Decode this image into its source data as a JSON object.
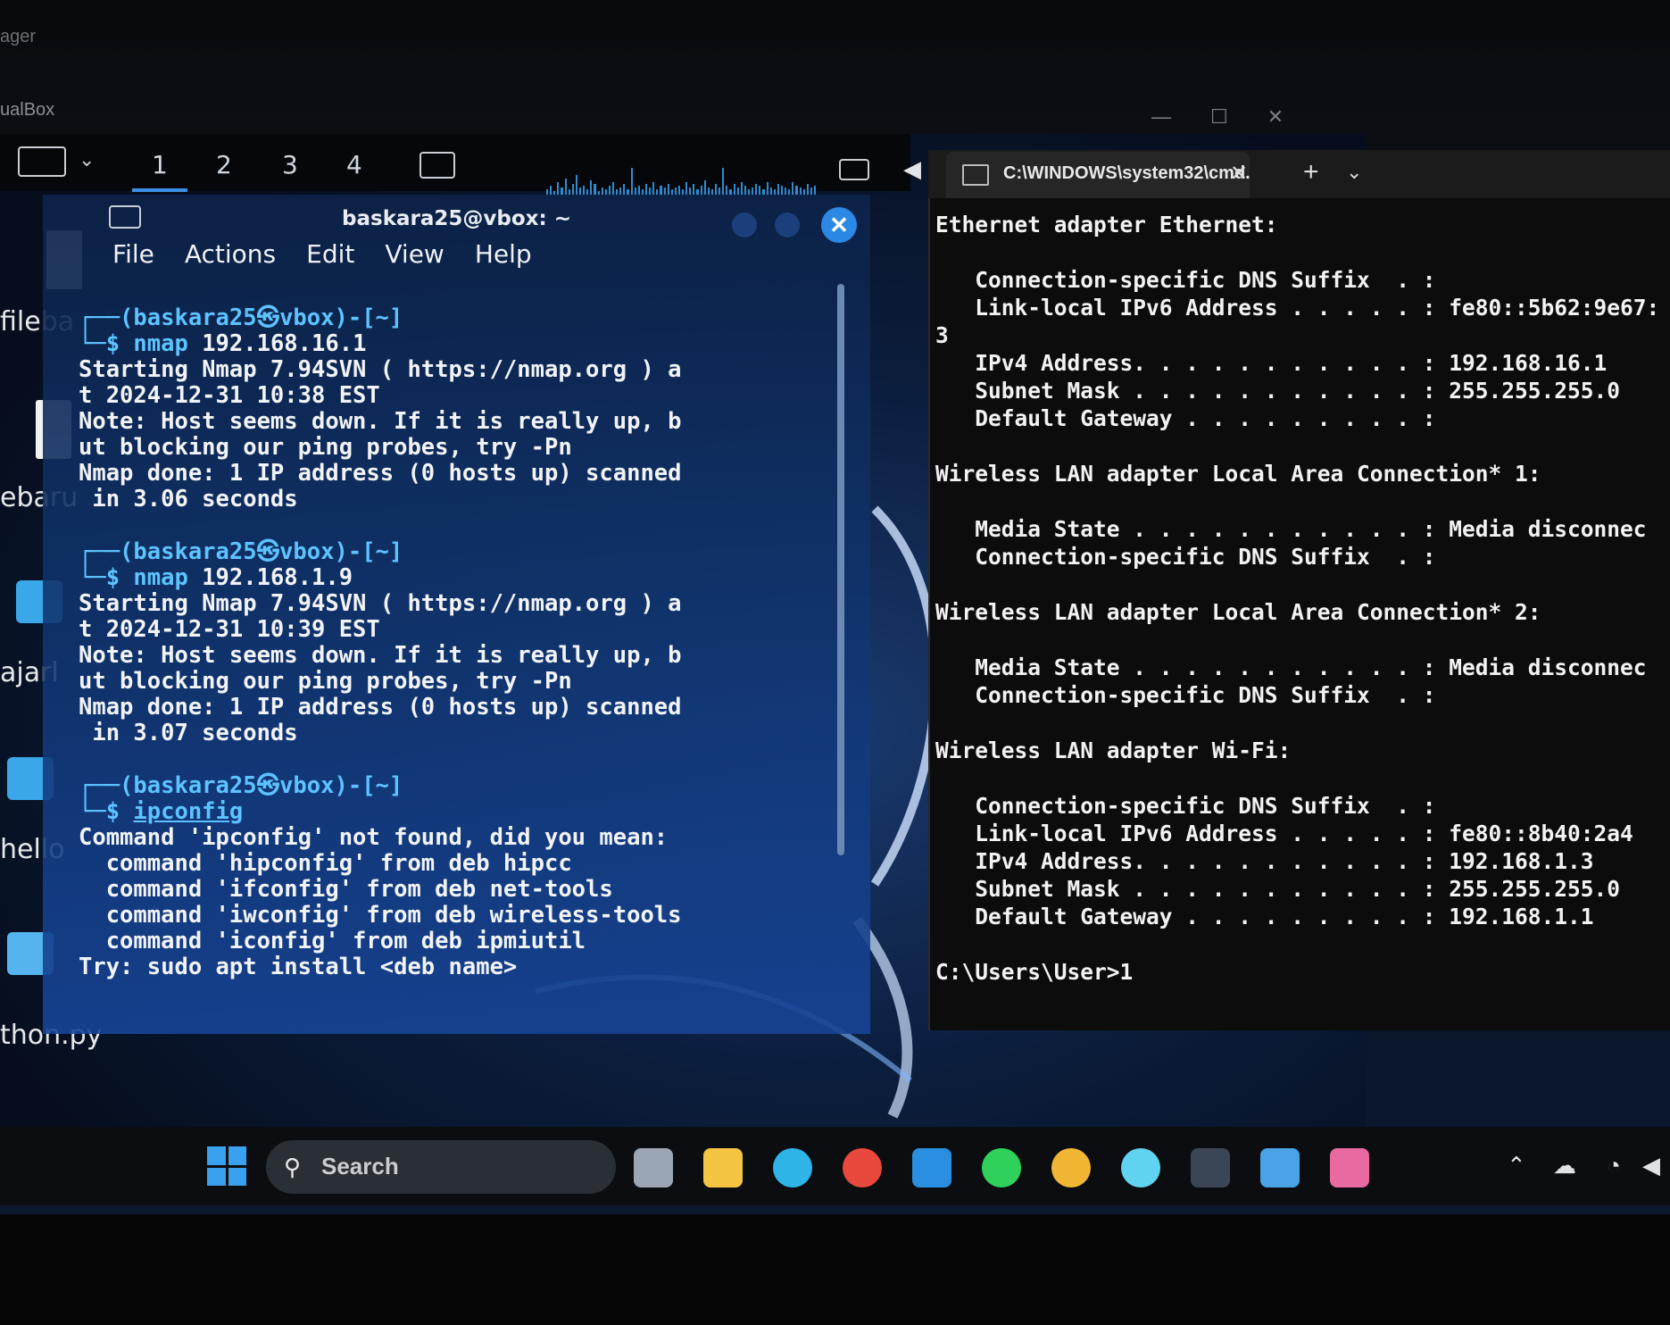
{
  "host": {
    "window_title_fragment": "ager",
    "vbox_title_fragment": "ualBox"
  },
  "xfce_panel": {
    "workspaces": [
      "1",
      "2",
      "3",
      "4"
    ],
    "active_workspace": "1"
  },
  "desktop_icons": [
    {
      "label": "fileba"
    },
    {
      "label": "ebaru"
    },
    {
      "label": "ajarl"
    },
    {
      "label": "hello"
    },
    {
      "label": "thon.py"
    }
  ],
  "kali_terminal": {
    "title": "baskara25@vbox: ~",
    "menu": [
      "File",
      "Actions",
      "Edit",
      "View",
      "Help"
    ],
    "blocks": [
      {
        "prompt": "┌──(baskara25㉿vbox)-[~]",
        "cmd_prefix": "└─$ ",
        "cmd_name": "nmap",
        "cmd_args": " 192.168.16.1",
        "output": [
          "Starting Nmap 7.94SVN ( https://nmap.org ) a",
          "t 2024-12-31 10:38 EST",
          "Note: Host seems down. If it is really up, b",
          "ut blocking our ping probes, try -Pn",
          "Nmap done: 1 IP address (0 hosts up) scanned",
          " in 3.06 seconds"
        ]
      },
      {
        "prompt": "┌──(baskara25㉿vbox)-[~]",
        "cmd_prefix": "└─$ ",
        "cmd_name": "nmap",
        "cmd_args": " 192.168.1.9",
        "output": [
          "Starting Nmap 7.94SVN ( https://nmap.org ) a",
          "t 2024-12-31 10:39 EST",
          "Note: Host seems down. If it is really up, b",
          "ut blocking our ping probes, try -Pn",
          "Nmap done: 1 IP address (0 hosts up) scanned",
          " in 3.07 seconds"
        ]
      },
      {
        "prompt": "┌──(baskara25㉿vbox)-[~]",
        "cmd_prefix": "└─$ ",
        "cmd_name": "ipconfig",
        "cmd_args": "",
        "output": [
          "Command 'ipconfig' not found, did you mean:",
          "  command 'hipconfig' from deb hipcc",
          "  command 'ifconfig' from deb net-tools",
          "  command 'iwconfig' from deb wireless-tools",
          "  command 'iconfig' from deb ipmiutil",
          "Try: sudo apt install <deb name>"
        ]
      }
    ]
  },
  "cmd_window": {
    "tab_title": "C:\\WINDOWS\\system32\\cmd.",
    "lines": [
      "Ethernet adapter Ethernet:",
      "",
      "   Connection-specific DNS Suffix  . :",
      "   Link-local IPv6 Address . . . . . : fe80::5b62:9e67:",
      "3",
      "   IPv4 Address. . . . . . . . . . . : 192.168.16.1",
      "   Subnet Mask . . . . . . . . . . . : 255.255.255.0",
      "   Default Gateway . . . . . . . . . :",
      "",
      "Wireless LAN adapter Local Area Connection* 1:",
      "",
      "   Media State . . . . . . . . . . . : Media disconnec",
      "   Connection-specific DNS Suffix  . :",
      "",
      "Wireless LAN adapter Local Area Connection* 2:",
      "",
      "   Media State . . . . . . . . . . . : Media disconnec",
      "   Connection-specific DNS Suffix  . :",
      "",
      "Wireless LAN adapter Wi-Fi:",
      "",
      "   Connection-specific DNS Suffix  . :",
      "   Link-local IPv6 Address . . . . . : fe80::8b40:2a4",
      "   IPv4 Address. . . . . . . . . . . : 192.168.1.3",
      "   Subnet Mask . . . . . . . . . . . : 255.255.255.0",
      "   Default Gateway . . . . . . . . . : 192.168.1.1",
      "",
      "C:\\Users\\User>1"
    ]
  },
  "taskbar": {
    "search_placeholder": "Search",
    "apps": [
      {
        "icon": "task-view-icon",
        "color": "#9aa6b4"
      },
      {
        "icon": "file-explorer-icon",
        "color": "#f4c542"
      },
      {
        "icon": "edge-icon",
        "color": "#2fb4e8"
      },
      {
        "icon": "chrome-icon",
        "color": "#e9483c"
      },
      {
        "icon": "vscode-icon",
        "color": "#2a8fe0"
      },
      {
        "icon": "whatsapp-icon",
        "color": "#2fd15a"
      },
      {
        "icon": "chrome-alt-icon",
        "color": "#f2b635"
      },
      {
        "icon": "circle-app-icon",
        "color": "#5fd3f0"
      },
      {
        "icon": "terminal-icon",
        "color": "#3a4656"
      },
      {
        "icon": "virtualbox-icon",
        "color": "#4aa3e6"
      },
      {
        "icon": "paint-app-icon",
        "color": "#e86aa0"
      }
    ]
  }
}
